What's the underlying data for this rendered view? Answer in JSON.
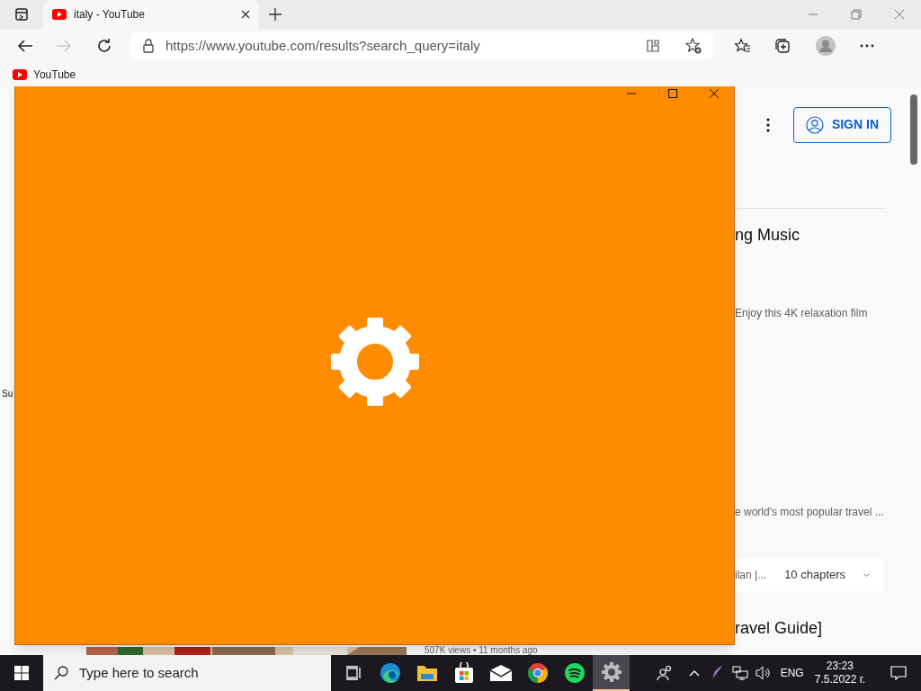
{
  "browser": {
    "tab": {
      "title": "italy - YouTube"
    },
    "url": "https://www.youtube.com/results?search_query=italy",
    "bookmarks": [
      "YouTube"
    ]
  },
  "page": {
    "side_label": "Su",
    "sign_in": "SIGN IN",
    "result_title_1": "ng Music",
    "result_desc_1": "Enjoy this 4K relaxation film",
    "result_desc_2": "e world's most popular travel ...",
    "chapter_label": "ilan |...",
    "chapters": "10 chapters",
    "result_title_2": "ravel Guide]",
    "result_meta": "507K views • 11 months ago"
  },
  "app_window": {
    "kind": "settings-splash"
  },
  "taskbar": {
    "search_placeholder": "Type here to search",
    "apps": [
      {
        "kind": "task-view",
        "selected": false
      },
      {
        "kind": "edge",
        "selected": false
      },
      {
        "kind": "explorer",
        "selected": false
      },
      {
        "kind": "store",
        "selected": false
      },
      {
        "kind": "mail",
        "selected": false
      },
      {
        "kind": "chrome",
        "selected": false
      },
      {
        "kind": "spotify",
        "selected": false
      },
      {
        "kind": "settings",
        "selected": true
      }
    ],
    "language": "ENG",
    "time": "23:23",
    "date": "7.5.2022 г."
  }
}
